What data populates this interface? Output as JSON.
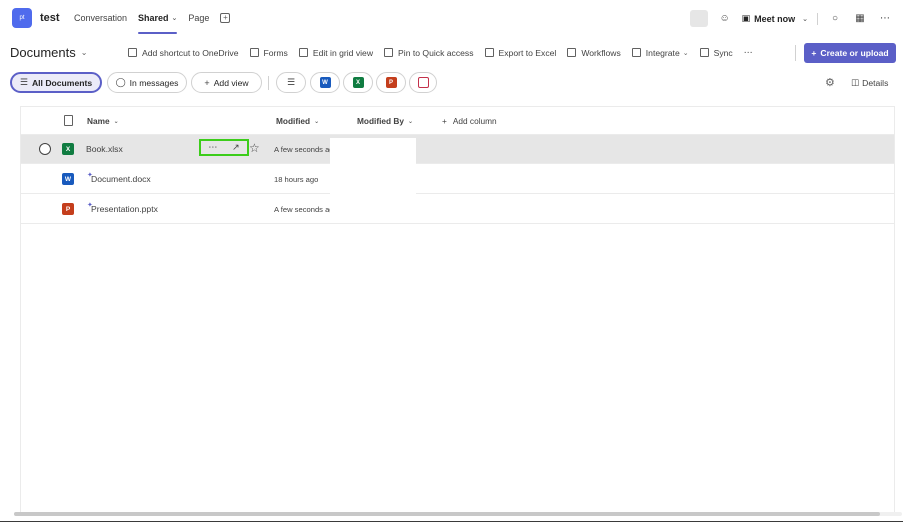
{
  "app": {
    "tile_text": "pt",
    "team_name": "test",
    "accent": "#5b5fc7"
  },
  "topnav": {
    "tabs": [
      {
        "label": "Conversation"
      },
      {
        "label": "Shared"
      },
      {
        "label": "Page"
      }
    ],
    "active_tab": "Shared",
    "add_tab_icon": "add-tab-icon"
  },
  "topright": {
    "meet_label": "Meet now",
    "more_label": "⋯"
  },
  "commandbar": {
    "library_title": "Documents",
    "commands": [
      {
        "label": "Add shortcut to OneDrive",
        "icon": "shortcut-icon"
      },
      {
        "label": "Forms",
        "icon": "forms-icon"
      },
      {
        "label": "Edit in grid view",
        "icon": "grid-icon"
      },
      {
        "label": "Pin to Quick access",
        "icon": "pin-icon"
      },
      {
        "label": "Export to Excel",
        "icon": "excel-icon"
      },
      {
        "label": "Workflows",
        "icon": "workflows-icon"
      },
      {
        "label": "Integrate",
        "icon": "integrate-icon"
      },
      {
        "label": "Sync",
        "icon": "sync-icon"
      },
      {
        "label": "⋯",
        "icon": "more-icon"
      }
    ],
    "create_label": "Create or upload"
  },
  "viewbar": {
    "views": [
      {
        "label": "All Documents"
      },
      {
        "label": "In messages"
      },
      {
        "label": "Add view"
      }
    ],
    "app_filters": [
      {
        "letter": "W",
        "color": "#185abd"
      },
      {
        "letter": "X",
        "color": "#107c41"
      },
      {
        "letter": "P",
        "color": "#c43e1c"
      },
      {
        "letter": "",
        "color": "#c4314b"
      }
    ],
    "details_label": "Details"
  },
  "list": {
    "columns": {
      "name": "Name",
      "modified": "Modified",
      "modified_by": "Modified By",
      "add_column": "Add column"
    },
    "rows": [
      {
        "name": "Book.xlsx",
        "modified": "A few seconds ago",
        "type": "xlsx",
        "color": "#107c41",
        "letter": "X",
        "new": false
      },
      {
        "name": "Document.docx",
        "modified": "18 hours ago",
        "type": "docx",
        "color": "#185abd",
        "letter": "W",
        "new": true
      },
      {
        "name": "Presentation.pptx",
        "modified": "A few seconds ago",
        "type": "pptx",
        "color": "#c43e1c",
        "letter": "P",
        "new": true
      }
    ],
    "row_action_labels": {
      "more": "⋯",
      "share": "↗"
    }
  }
}
